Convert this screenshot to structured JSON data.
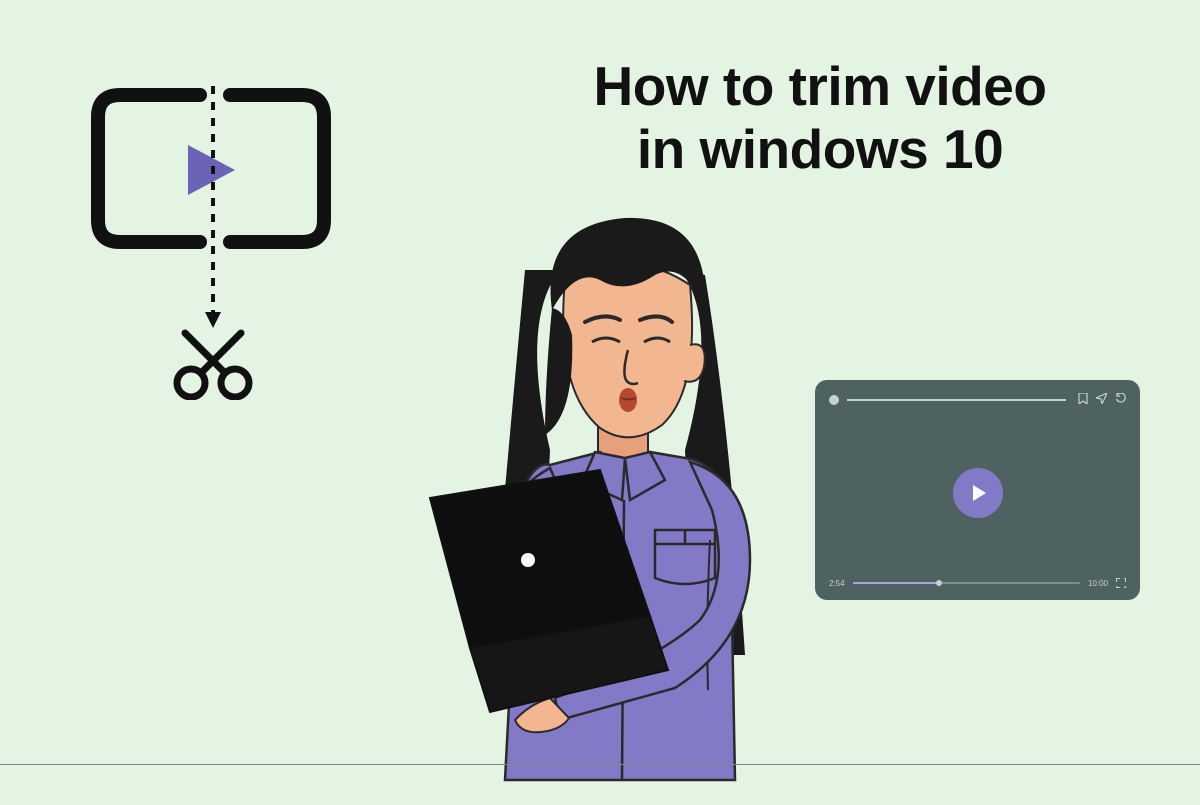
{
  "title_line1": "How to trim video",
  "title_line2": "in windows 10",
  "player": {
    "time_start": "2:54",
    "time_end": "10:00",
    "icons": {
      "bookmark": "bookmark-icon",
      "send": "send-icon",
      "refresh": "refresh-icon",
      "fullscreen": "fullscreen-icon"
    }
  },
  "colors": {
    "accent": "#8279c7",
    "bg": "#e3f5e2",
    "player_bg": "#4f6262"
  }
}
